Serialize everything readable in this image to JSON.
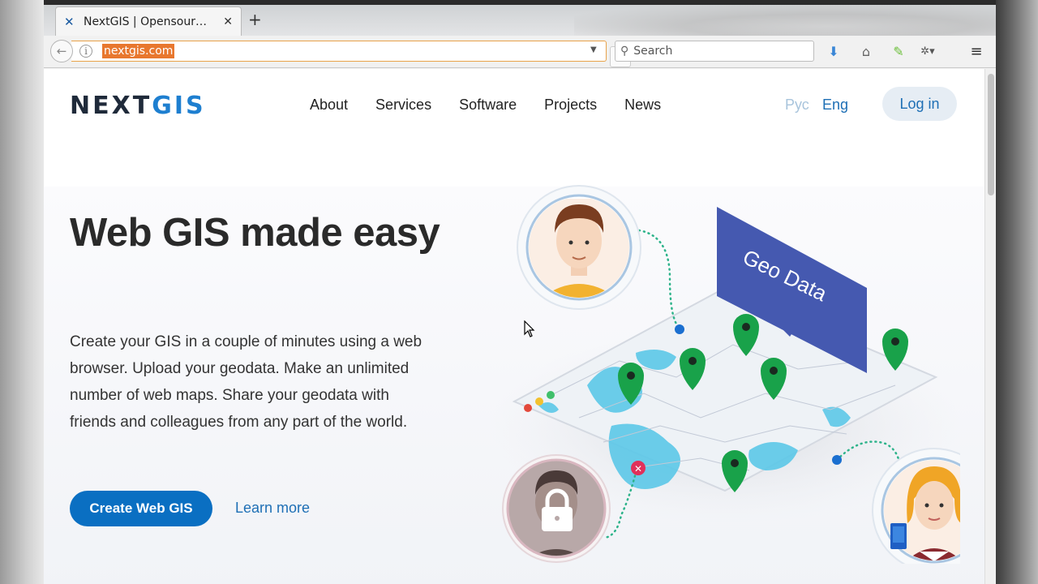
{
  "browser": {
    "tab_title": "NextGIS | Opensour…",
    "url": "nextgis.com",
    "search_placeholder": "Search"
  },
  "site": {
    "logo_prefix": "NEXT",
    "logo_suffix": "GIS",
    "nav": [
      "About",
      "Services",
      "Software",
      "Projects",
      "News"
    ],
    "lang_ru": "Рус",
    "lang_en": "Eng",
    "login": "Log in"
  },
  "hero": {
    "title": "Web GIS made easy",
    "body": "Create your GIS in a couple of minutes using a web browser. Upload your geodata. Make an unlimited number of web maps. Share your geodata with friends and colleagues from any part of the world.",
    "cta": "Create Web GIS",
    "learn_more": "Learn more",
    "illustration_label": "Geo Data"
  },
  "colors": {
    "brand_blue": "#0a6fc2",
    "pin_green": "#19a24a",
    "map_water": "#5cc8e8",
    "flag_blue": "#4559b0"
  }
}
